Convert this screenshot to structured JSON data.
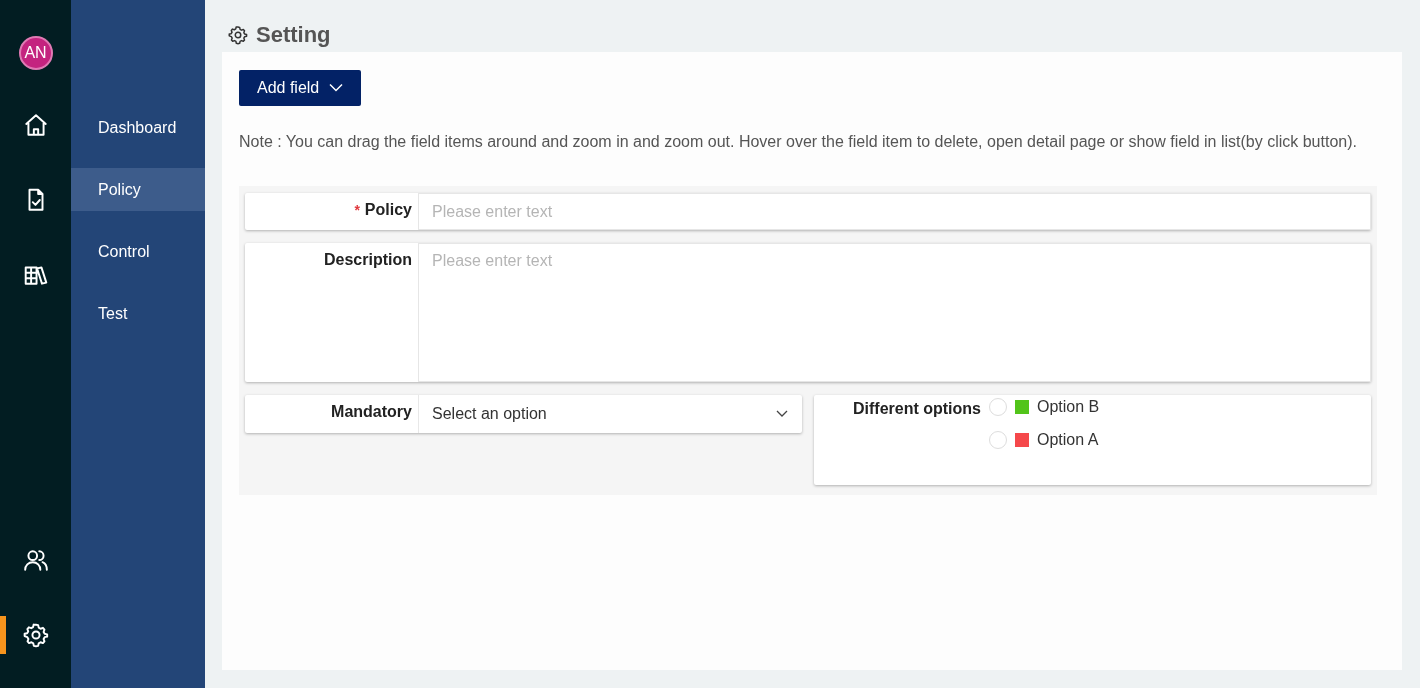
{
  "rail": {
    "avatar": "AN",
    "items": [
      {
        "kind": "home",
        "selected": false
      },
      {
        "kind": "file-check",
        "selected": false
      },
      {
        "kind": "library",
        "selected": false
      },
      {
        "kind": "users",
        "selected": false
      },
      {
        "kind": "settings",
        "selected": true
      }
    ]
  },
  "nav": {
    "items": [
      {
        "label": "Dashboard",
        "selected": false
      },
      {
        "label": "Policy",
        "selected": true
      },
      {
        "label": "Control",
        "selected": false
      },
      {
        "label": "Test",
        "selected": false
      }
    ]
  },
  "page": {
    "title": "Setting",
    "add_button": "Add field",
    "note": "Note : You can drag the field items around and zoom in and zoom out. Hover over the field item to delete, open detail page or show field in list(by click button)."
  },
  "fields": [
    {
      "kind": "text",
      "label": "Policy",
      "required_mark": "*",
      "placeholder": "Please enter text"
    },
    {
      "kind": "textarea",
      "label": "Description",
      "placeholder": "Please enter text"
    },
    {
      "kind": "select",
      "label": "Mandatory",
      "value": "Select an option"
    },
    {
      "kind": "radio",
      "label": "Different options",
      "options": [
        {
          "label": "Option B",
          "color": "#52c41a",
          "selected": false
        },
        {
          "label": "Option A",
          "color": "#f5484b",
          "selected": false
        }
      ]
    }
  ]
}
